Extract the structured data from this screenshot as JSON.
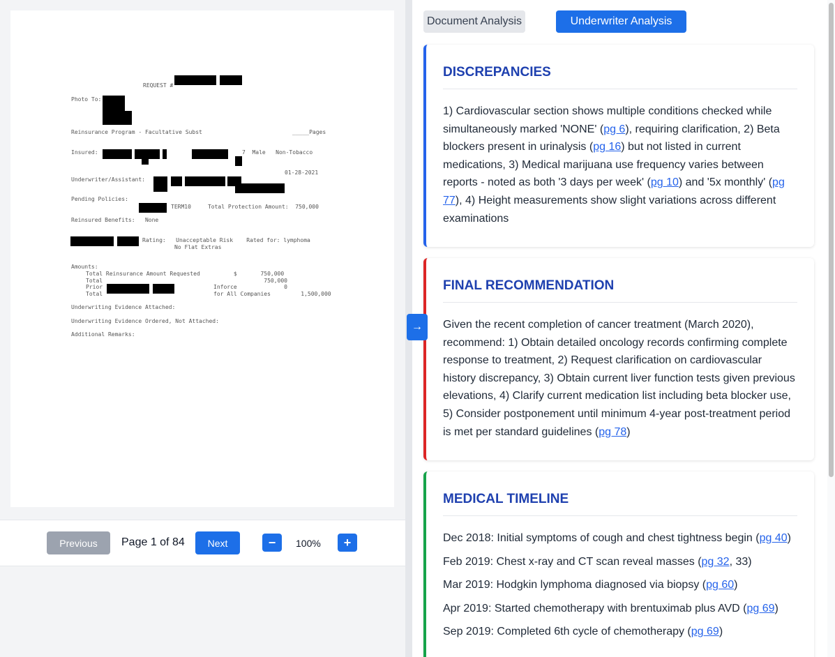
{
  "document": {
    "request_prefix": "REQUEST #",
    "photo_to": "Photo To:",
    "program": "Reinsurance Program - Facultative Subst",
    "pages": "_____Pages",
    "insured_label": "Insured:",
    "insured_tail": "7  Male   Non-Tobacco",
    "date": "01-28-2021",
    "underwriter_label": "Underwriter/Assistant:",
    "pending_label": "Pending Policies:",
    "pending_tail": "TERM10     Total Protection Amount:  750,000",
    "benefits": "Reinsured Benefits:   None",
    "rating": "Rating:   Unacceptable Risk    Rated for: lymphoma",
    "rating2": "No Flat Extras",
    "amounts": "Amounts:",
    "total_req": "Total Reinsurance Amount Requested          $       750,000",
    "total": "Total                                                750,000",
    "prior": "Prior                                 Inforce              0",
    "total_all": "Total                                 for All Companies         1,500,000",
    "evidence_attached": "Underwriting Evidence Attached:",
    "evidence_ordered": "Underwriting Evidence Ordered, Not Attached:",
    "remarks": "Additional Remarks:"
  },
  "pager": {
    "previous": "Previous",
    "page_info": "Page 1 of 84",
    "next": "Next",
    "zoom_out": "−",
    "zoom": "100%",
    "zoom_in": "+"
  },
  "collapse_icon": "→",
  "tabs": {
    "document_analysis": "Document Analysis",
    "underwriter_analysis": "Underwriter Analysis"
  },
  "discrepancies": {
    "title": "DISCREPANCIES",
    "t1": "1) Cardiovascular section shows multiple conditions checked while simultaneously marked 'NONE' (",
    "l1": "pg 6",
    "t2": "), requiring clarification, 2) Beta blockers present in urinalysis (",
    "l2": "pg 16",
    "t3": ") but not listed in current medications, 3) Medical marijuana use frequency varies between reports - noted as both '3 days per week' (",
    "l3": "pg 10",
    "t4": ") and '5x monthly' (",
    "l4": "pg 77",
    "t5": "), 4) Height measurements show slight variations across different examinations"
  },
  "recommendation": {
    "title": "FINAL RECOMMENDATION",
    "t1": "Given the recent completion of cancer treatment (March 2020), recommend: 1) Obtain detailed oncology records confirming complete response to treatment, 2) Request clarification on cardiovascular history discrepancy, 3) Obtain current liver function tests given previous elevations, 4) Clarify current medication list including beta blocker use, 5) Consider postponement until minimum 4-year post-treatment period is met per standard guidelines (",
    "l1": "pg 78",
    "t2": ")"
  },
  "timeline": {
    "title": "MEDICAL TIMELINE",
    "items": [
      {
        "text": "Dec 2018: Initial symptoms of cough and chest tightness begin (",
        "link": "pg 40",
        "tail": ")"
      },
      {
        "text": "Feb 2019: Chest x-ray and CT scan reveal masses (",
        "link": "pg 32",
        "tail": ", 33)"
      },
      {
        "text": "Mar 2019: Hodgkin lymphoma diagnosed via biopsy (",
        "link": "pg 60",
        "tail": ")"
      },
      {
        "text": "Apr 2019: Started chemotherapy with brentuximab plus AVD (",
        "link": "pg 69",
        "tail": ")"
      },
      {
        "text": "Sep 2019: Completed 6th cycle of chemotherapy (",
        "link": "pg 69",
        "tail": ")"
      }
    ]
  }
}
